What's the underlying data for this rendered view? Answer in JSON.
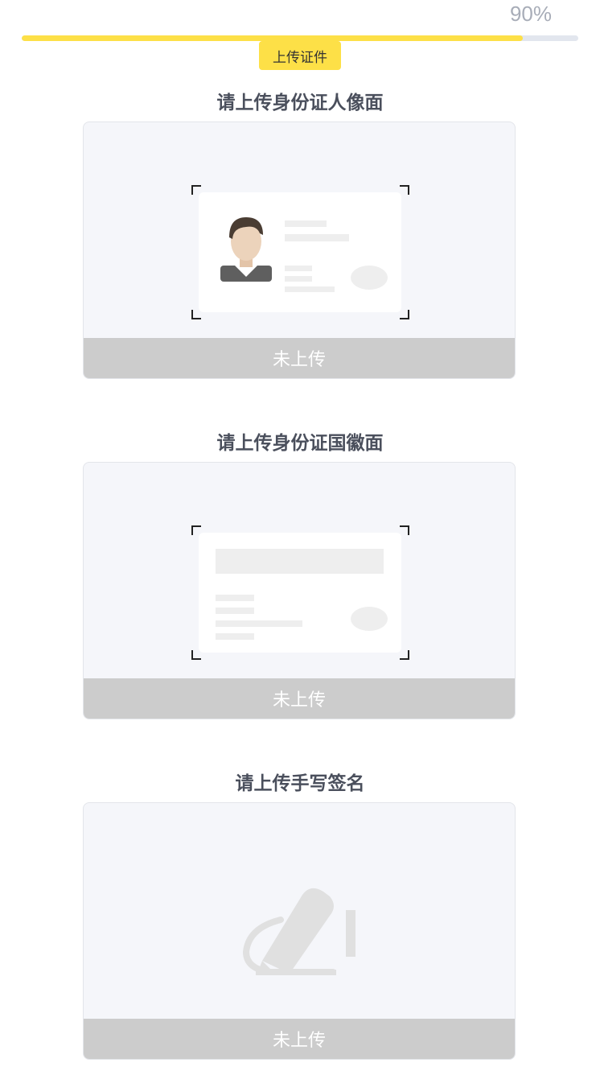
{
  "progress": {
    "percent_text": "90%",
    "value": 0.9
  },
  "step": {
    "label": "上传证件"
  },
  "sections": [
    {
      "title": "请上传身份证人像面",
      "status": "未上传"
    },
    {
      "title": "请上传身份证国徽面",
      "status": "未上传"
    },
    {
      "title": "请上传手写签名",
      "status": "未上传"
    }
  ],
  "colors": {
    "accent": "#fde047",
    "track": "#e2e6ee",
    "status_bar": "#cccccc"
  }
}
